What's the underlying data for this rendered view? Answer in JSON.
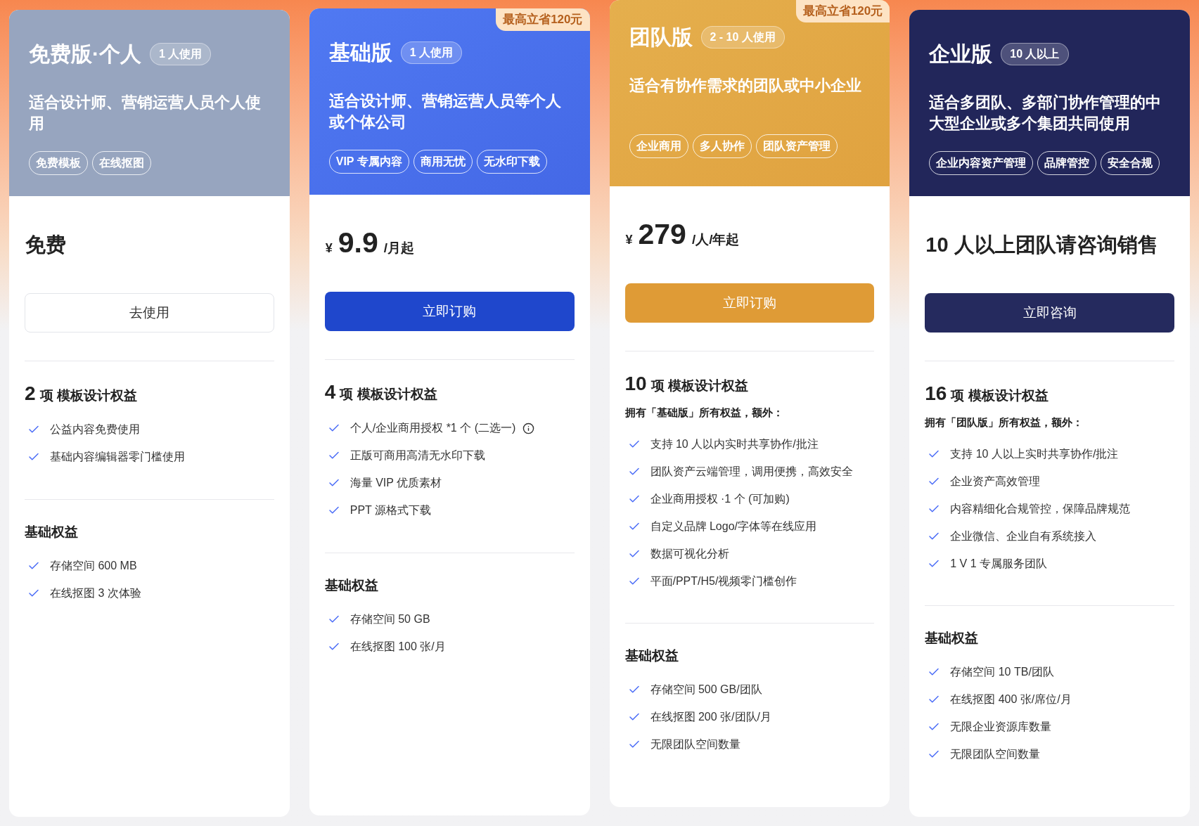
{
  "plans": [
    {
      "kind": "free",
      "title": "免费版·个人",
      "users": "1 人使用",
      "description": "适合设计师、营销运营人员个人使用",
      "tags": [
        "免费模板",
        "在线抠图"
      ],
      "price": {
        "kind": "text",
        "text": "免费"
      },
      "button": "去使用",
      "sections": [
        {
          "count": "2",
          "title": "项 模板设计权益",
          "items": [
            {
              "text": "公益内容免费使用",
              "info": false
            },
            {
              "text": "基础内容编辑器零门槛使用",
              "info": false
            }
          ]
        },
        {
          "title": "基础权益",
          "items": [
            {
              "text": "存储空间 600 MB",
              "info": false
            },
            {
              "text": "在线抠图 3 次体验",
              "info": false
            }
          ]
        }
      ]
    },
    {
      "kind": "basic",
      "badge": "最高立省120元",
      "title": "基础版",
      "users": "1 人使用",
      "description": "适合设计师、营销运营人员等个人或个体公司",
      "tags": [
        "VIP 专属内容",
        "商用无忧",
        "无水印下载"
      ],
      "price": {
        "kind": "amount",
        "currency": "¥",
        "amount": "9.9",
        "unit": "/月起"
      },
      "button": "立即订购",
      "sections": [
        {
          "count": "4",
          "title": "项 模板设计权益",
          "items": [
            {
              "text": "个人/企业商用授权 *1 个 (二选一)",
              "info": true
            },
            {
              "text": "正版可商用高清无水印下载",
              "info": false
            },
            {
              "text": "海量 VIP 优质素材",
              "info": false
            },
            {
              "text": "PPT 源格式下载",
              "info": false
            }
          ]
        },
        {
          "title": "基础权益",
          "items": [
            {
              "text": "存储空间 50 GB",
              "info": false
            },
            {
              "text": "在线抠图 100 张/月",
              "info": false
            }
          ]
        }
      ]
    },
    {
      "kind": "team",
      "badge": "最高立省120元",
      "title": "团队版",
      "users": "2 - 10 人使用",
      "description": "适合有协作需求的团队或中小企业",
      "tags": [
        "企业商用",
        "多人协作",
        "团队资产管理"
      ],
      "price": {
        "kind": "amount",
        "currency": "¥",
        "amount": "279",
        "unit": "/人/年起"
      },
      "button": "立即订购",
      "sections": [
        {
          "count": "10",
          "title": "项 模板设计权益",
          "subtitle": "拥有「基础版」所有权益，额外：",
          "items": [
            {
              "text": "支持 10 人以内实时共享协作/批注",
              "info": false
            },
            {
              "text": "团队资产云端管理，调用便携，高效安全",
              "info": false
            },
            {
              "text": "企业商用授权 ·1 个 (可加购)",
              "info": false
            },
            {
              "text": "自定义品牌 Logo/字体等在线应用",
              "info": false
            },
            {
              "text": "数据可视化分析",
              "info": false
            },
            {
              "text": "平面/PPT/H5/视频零门槛创作",
              "info": false
            }
          ]
        },
        {
          "title": "基础权益",
          "items": [
            {
              "text": "存储空间 500 GB/团队",
              "info": false
            },
            {
              "text": "在线抠图 200 张/团队/月",
              "info": false
            },
            {
              "text": "无限团队空间数量",
              "info": false
            }
          ]
        }
      ]
    },
    {
      "kind": "enterprise",
      "title": "企业版",
      "users": "10 人以上",
      "description": "适合多团队、多部门协作管理的中大型企业或多个集团共同使用",
      "tags": [
        "企业内容资产管理",
        "品牌管控",
        "安全合规"
      ],
      "price": {
        "kind": "text",
        "text": "10 人以上团队请咨询销售"
      },
      "button": "立即咨询",
      "sections": [
        {
          "count": "16",
          "title": "项 模板设计权益",
          "subtitle": "拥有「团队版」所有权益，额外：",
          "items": [
            {
              "text": "支持 10 人以上实时共享协作/批注",
              "info": false
            },
            {
              "text": "企业资产高效管理",
              "info": false
            },
            {
              "text": "内容精细化合规管控，保障品牌规范",
              "info": false
            },
            {
              "text": "企业微信、企业自有系统接入",
              "info": false
            },
            {
              "text": "1 V 1 专属服务团队",
              "info": false
            }
          ]
        },
        {
          "title": "基础权益",
          "items": [
            {
              "text": "存储空间 10 TB/团队",
              "info": false
            },
            {
              "text": "在线抠图 400 张/席位/月",
              "info": false
            },
            {
              "text": "无限企业资源库数量",
              "info": false
            },
            {
              "text": "无限团队空间数量",
              "info": false
            }
          ]
        }
      ]
    }
  ]
}
